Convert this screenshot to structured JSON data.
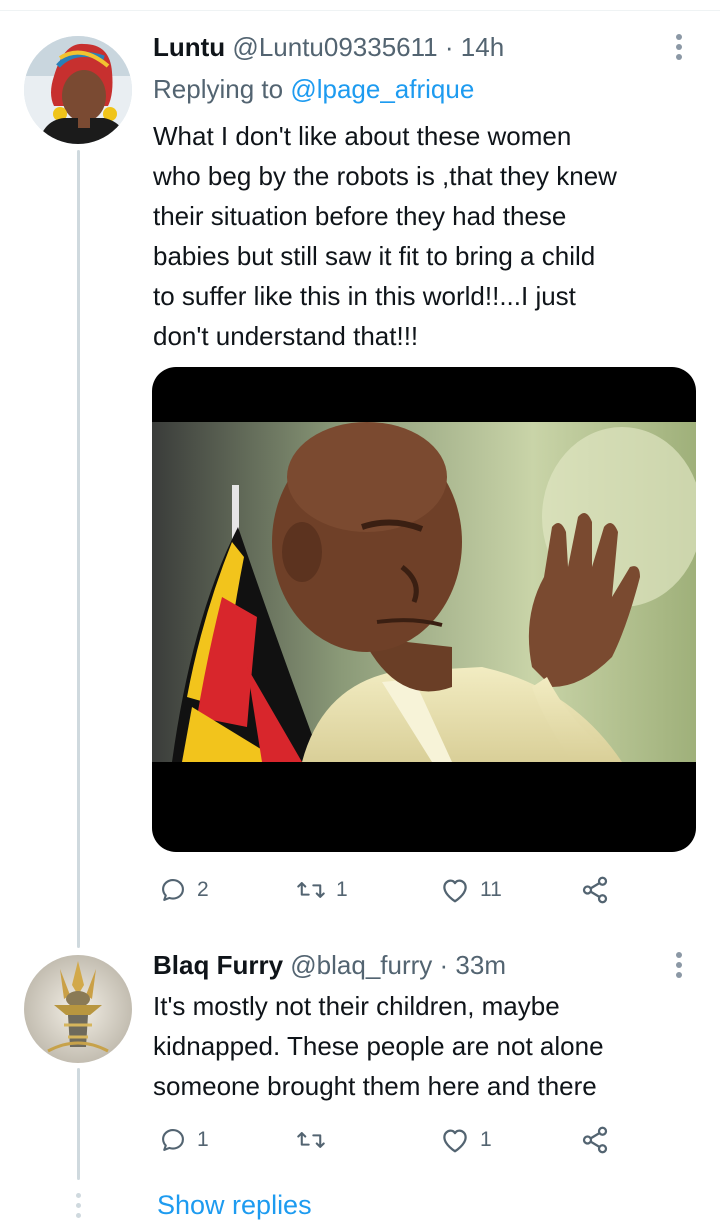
{
  "tweets": [
    {
      "display_name": "Luntu",
      "handle": "@Luntu09335611",
      "separator": "·",
      "time": "14h",
      "replying_prefix": "Replying to",
      "replying_to": "@lpage_afrique",
      "text_lines": [
        "What I don't like  about these women",
        "who beg by the robots is ,that they knew",
        "their situation before  they had these",
        "babies but still saw it fit to bring a child",
        "to suffer like this in this world!!...I just",
        "don't understand that!!!"
      ],
      "replies": "2",
      "retweets": "1",
      "likes": "11"
    },
    {
      "display_name": "Blaq Furry",
      "handle": "@blaq_furry",
      "separator": "·",
      "time": "33m",
      "text_lines": [
        "It's mostly not their children, maybe",
        "kidnapped. These people are not alone",
        "someone brought them here and there"
      ],
      "replies": "1",
      "retweets": "",
      "likes": "1"
    }
  ],
  "show_replies": "Show replies",
  "icons": [
    "more-icon",
    "reply-icon",
    "retweet-icon",
    "like-icon",
    "share-icon"
  ],
  "colors": {
    "link": "#1d9bf0",
    "secondary": "#536471",
    "thread_line": "#cfd9de",
    "text": "#0f1419"
  }
}
